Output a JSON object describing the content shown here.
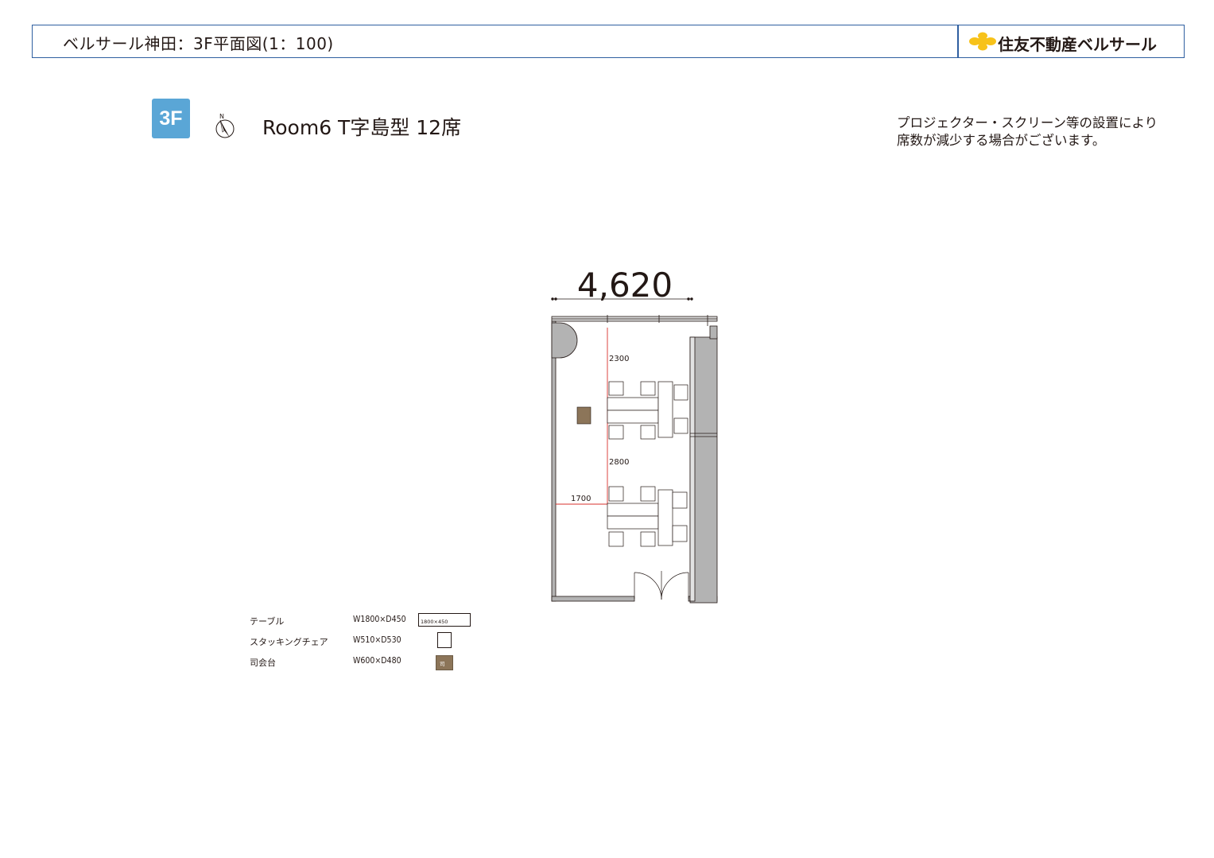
{
  "header": {
    "title": "ベルサール神田：3F平面図(1：100)",
    "brand": "住友不動産ベルサール"
  },
  "floor_badge": "3F",
  "north_label": "N",
  "room_title": "Room6 T字島型 12席",
  "note": {
    "line1": "プロジェクター・スクリーン等の設置により",
    "line2": "席数が減少する場合がございます。"
  },
  "plan": {
    "width_dim": "4,620",
    "dim_2300": "2300",
    "dim_2800": "2800",
    "dim_1700": "1700"
  },
  "legend": [
    {
      "name": "テーブル",
      "spec": "W1800×D450",
      "swatch_label": "1800×450"
    },
    {
      "name": "スタッキングチェア",
      "spec": "W510×D530",
      "swatch_label": ""
    },
    {
      "name": "司会台",
      "spec": "W600×D480",
      "swatch_label": "司"
    }
  ],
  "colors": {
    "header_border": "#2f5fa0",
    "badge": "#5aa6d6",
    "logo": "#f7c21a",
    "wall": "#a9a9a9",
    "dimension_red": "#d9302c",
    "podium": "#8c7559"
  }
}
